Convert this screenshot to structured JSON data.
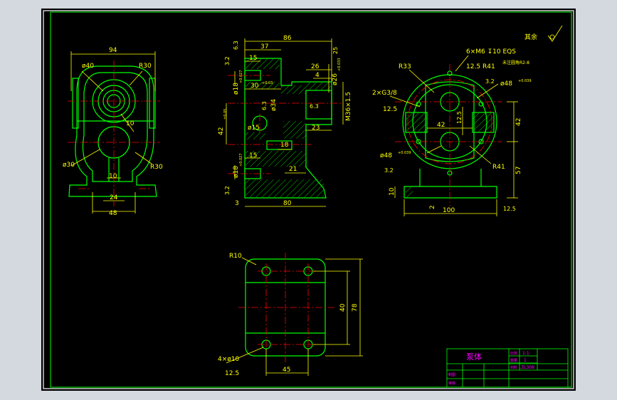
{
  "colors": {
    "background": "#000000",
    "frame": "#ffffff",
    "outline": "#00ff00",
    "dimension": "#ffff00",
    "centerline": "#ff0000",
    "hatch": "#00ff00",
    "title_text": "#ff00ff",
    "window": "#d4d9e0"
  },
  "front_view": {
    "dims": {
      "width_top": "94",
      "bore": "ø40",
      "r_top": "R30",
      "offset": "10",
      "dia_low": "ø30",
      "r_low": "R30",
      "slot": "10",
      "base_inner": "24",
      "base_width": "48"
    }
  },
  "section_view": {
    "dims": {
      "total": "86",
      "d37": "37",
      "d15a": "15",
      "d30": "30",
      "tol30": "+0.03",
      "d26": "26",
      "d4": "4",
      "bore18a": "ø18",
      "tol18a": "+0.027",
      "bore26": "ø26",
      "tol26": "+0.033",
      "thread": "M36×1.5",
      "d34": "ø34",
      "d42": "42",
      "tol42": "±0.05",
      "d15b": "ø15",
      "d23": "23",
      "d18": "18",
      "d15c": "15",
      "d21": "21",
      "bore18b": "ø18",
      "tol18b": "+0.027",
      "d3": "3",
      "d80": "80"
    },
    "roughness": [
      "3.2",
      "6.3",
      "3.2",
      "25",
      "6.3",
      "6.3"
    ]
  },
  "side_view": {
    "notes": {
      "holes": "6×M6 ↧10 EQS",
      "rough125": "12.5",
      "r41a": "R41",
      "r33": "R33",
      "pipe": "2×G3/8",
      "pipe_rough": "12.5",
      "rough32a": "3.2",
      "bore48a": "ø48",
      "tol48a": "+0.039",
      "d42h": "42",
      "rough125b": "12.5",
      "d42v": "42",
      "bore48b": "ø48",
      "tol48b": "+0.039",
      "rough32b": "3.2",
      "r41b": "R41",
      "d57": "57",
      "d10": "10",
      "d2": "2",
      "d100": "100",
      "rough125c": "12.5"
    },
    "remaining_label": "其余",
    "unmarked_note": "未注圆角R2-8"
  },
  "bottom_view": {
    "dims": {
      "corner": "R10",
      "d40": "40",
      "d78": "78",
      "holes": "4×ø10",
      "rough": "12.5",
      "d45": "45"
    }
  },
  "title_block": {
    "part_name": "泵体",
    "scale": "1:1",
    "qty": "1",
    "drawing_no": "ZL308",
    "small_labels": [
      "比例",
      "数量",
      "材料",
      "制图",
      "审核"
    ]
  }
}
